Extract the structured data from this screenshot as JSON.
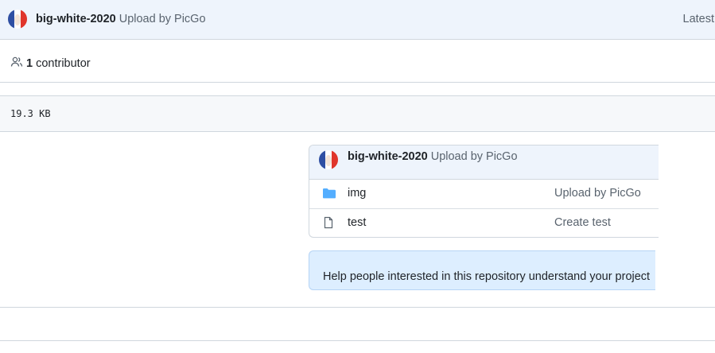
{
  "commit_bar": {
    "author": "big-white-2020",
    "message": "Upload by PicGo",
    "latest_label": "Latest"
  },
  "contributors": {
    "icon": "people-icon",
    "count": "1",
    "label": "contributor"
  },
  "file": {
    "size": "19.3 KB"
  },
  "repo_preview": {
    "author": "big-white-2020",
    "message": "Upload by PicGo",
    "rows": [
      {
        "name": "img",
        "type": "folder",
        "icon": "folder-icon",
        "commit": "Upload by PicGo"
      },
      {
        "name": "test",
        "type": "file",
        "icon": "file-icon",
        "commit": "Create test"
      }
    ]
  },
  "readme_banner": {
    "text": "Help people interested in this repository understand your project"
  },
  "colors": {
    "accent_bg": "#eef4fc",
    "banner_bg": "#ddeeff",
    "folder": "#54aeff",
    "border": "#d0d7de"
  }
}
